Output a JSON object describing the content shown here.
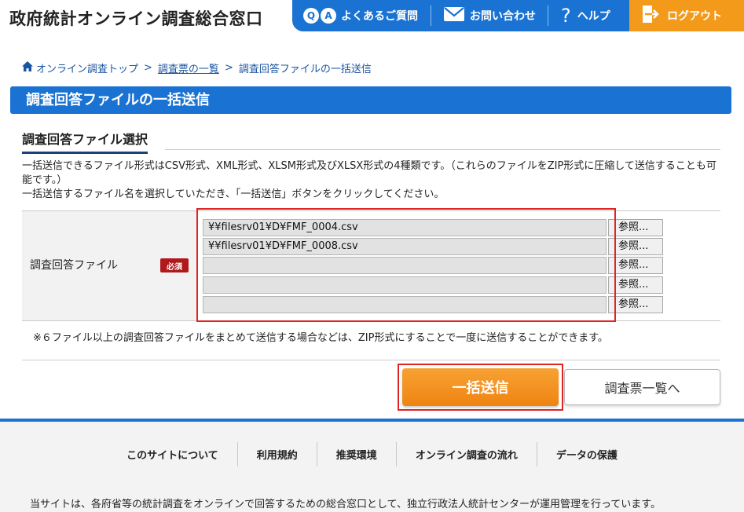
{
  "header": {
    "site_title": "政府統計オンライン調査総合窓口",
    "faq_icon_letters": [
      "Q",
      "A"
    ],
    "faq_label": "よくあるご質問",
    "contact_label": "お問い合わせ",
    "help_icon": "?",
    "help_label": "ヘルプ",
    "logout_label": "ログアウト",
    "nav_color": "#1a73d2",
    "logout_color": "#f39a1b"
  },
  "breadcrumb": {
    "home": "オンライン調査トップ",
    "separator": ">",
    "survey_list": "調査票の一覧",
    "current": "調査回答ファイルの一括送信"
  },
  "page_title": "調査回答ファイルの一括送信",
  "section": {
    "heading": "調査回答ファイル選択",
    "description_line1": "一括送信できるファイル形式はCSV形式、XML形式、XLSM形式及びXLSX形式の4種類です。（これらのファイルをZIP形式に圧縮して送信することも可能です。）",
    "description_line2": "一括送信するファイル名を選択していただき、「一括送信」ボタンをクリックしてください。"
  },
  "form": {
    "label": "調査回答ファイル",
    "required_badge": "必須",
    "browse_label": "参照...",
    "files": [
      "¥¥filesrv01¥D¥FMF_0004.csv",
      "¥¥filesrv01¥D¥FMF_0008.csv",
      "",
      "",
      ""
    ],
    "note": "※６ファイル以上の調査回答ファイルをまとめて送信する場合などは、ZIP形式にすることで一度に送信することができます。"
  },
  "buttons": {
    "submit": "一括送信",
    "back_to_list": "調査票一覧へ"
  },
  "footer": {
    "links": [
      "このサイトについて",
      "利用規約",
      "推奨環境",
      "オンライン調査の流れ",
      "データの保護"
    ],
    "text": "当サイトは、各府省等の統計調査をオンラインで回答するための総合窓口として、独立行政法人統計センターが運用管理を行っています。"
  }
}
